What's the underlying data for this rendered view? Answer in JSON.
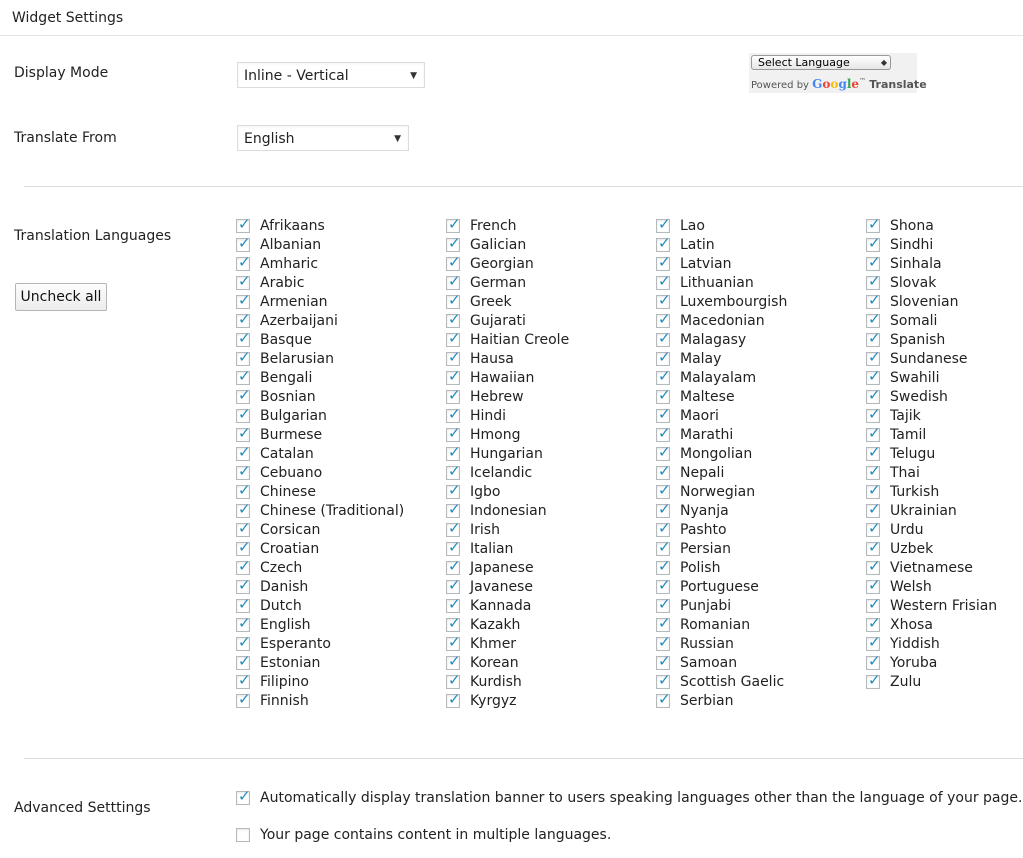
{
  "header": {
    "title": "Widget Settings"
  },
  "display_mode": {
    "label": "Display Mode",
    "value": "Inline - Vertical"
  },
  "translate_from": {
    "label": "Translate From",
    "value": "English"
  },
  "google_widget": {
    "select_label": "Select Language",
    "powered_by": "Powered by",
    "google": "Google",
    "tm": "™",
    "translate": "Translate"
  },
  "translation_languages": {
    "label": "Translation Languages",
    "uncheck_all": "Uncheck all",
    "columns": [
      [
        "Afrikaans",
        "Albanian",
        "Amharic",
        "Arabic",
        "Armenian",
        "Azerbaijani",
        "Basque",
        "Belarusian",
        "Bengali",
        "Bosnian",
        "Bulgarian",
        "Burmese",
        "Catalan",
        "Cebuano",
        "Chinese",
        "Chinese (Traditional)",
        "Corsican",
        "Croatian",
        "Czech",
        "Danish",
        "Dutch",
        "English",
        "Esperanto",
        "Estonian",
        "Filipino",
        "Finnish"
      ],
      [
        "French",
        "Galician",
        "Georgian",
        "German",
        "Greek",
        "Gujarati",
        "Haitian Creole",
        "Hausa",
        "Hawaiian",
        "Hebrew",
        "Hindi",
        "Hmong",
        "Hungarian",
        "Icelandic",
        "Igbo",
        "Indonesian",
        "Irish",
        "Italian",
        "Japanese",
        "Javanese",
        "Kannada",
        "Kazakh",
        "Khmer",
        "Korean",
        "Kurdish",
        "Kyrgyz"
      ],
      [
        "Lao",
        "Latin",
        "Latvian",
        "Lithuanian",
        "Luxembourgish",
        "Macedonian",
        "Malagasy",
        "Malay",
        "Malayalam",
        "Maltese",
        "Maori",
        "Marathi",
        "Mongolian",
        "Nepali",
        "Norwegian",
        "Nyanja",
        "Pashto",
        "Persian",
        "Polish",
        "Portuguese",
        "Punjabi",
        "Romanian",
        "Russian",
        "Samoan",
        "Scottish Gaelic",
        "Serbian"
      ],
      [
        "Shona",
        "Sindhi",
        "Sinhala",
        "Slovak",
        "Slovenian",
        "Somali",
        "Spanish",
        "Sundanese",
        "Swahili",
        "Swedish",
        "Tajik",
        "Tamil",
        "Telugu",
        "Thai",
        "Turkish",
        "Ukrainian",
        "Urdu",
        "Uzbek",
        "Vietnamese",
        "Welsh",
        "Western Frisian",
        "Xhosa",
        "Yiddish",
        "Yoruba",
        "Zulu"
      ]
    ],
    "checked": true
  },
  "advanced": {
    "label": "Advanced Setttings",
    "options": [
      {
        "label": "Automatically display translation banner to users speaking languages other than the language of your page.",
        "checked": true
      },
      {
        "label": "Your page contains content in multiple languages.",
        "checked": false
      }
    ]
  },
  "colors": {
    "check": "#1e8cbe",
    "divider": "#dcdcdc"
  },
  "icons": {
    "check": "check-icon",
    "dropdown": "chevron-down-icon"
  }
}
